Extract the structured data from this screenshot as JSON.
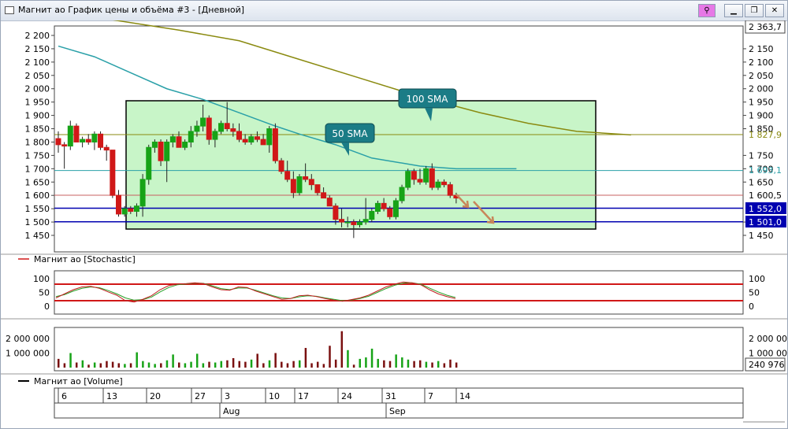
{
  "window": {
    "title": "Магнит ао График цены и объёма #3 - [Дневной]",
    "buttons": [
      "link-icon",
      "minimize-icon",
      "restore-icon",
      "close-icon"
    ]
  },
  "main_pane": {
    "y_ticks": [
      "2 200",
      "2 150",
      "2 100",
      "2 050",
      "2 000",
      "1 950",
      "1 900",
      "1 850",
      "1 800",
      "1 750",
      "1 700",
      "1 650",
      "1 600",
      "1 550",
      "1 500",
      "1 450"
    ],
    "right_ticks": [
      "2 150",
      "2 100",
      "2 050",
      "2 000",
      "1 950",
      "1 900",
      "1 850",
      "1 750",
      "1 700",
      "1 650",
      "1 500",
      "1 450"
    ],
    "top_price": "2 363,7",
    "labels": {
      "sma100": "1 827,9",
      "sma50": "1 693,1",
      "close": "1 600,5",
      "support1": "1 552,0",
      "support2": "1 501,0"
    },
    "callouts": {
      "sma100": "100 SMA",
      "sma50": "50 SMA"
    },
    "colors": {
      "up": "#17a317",
      "down": "#d01818",
      "sma50": "#2aa0a8",
      "sma100": "#8a8a10",
      "support": "#0000b0",
      "zone": "#c8f5c8",
      "arrow": "#c8865a"
    }
  },
  "stoch_pane": {
    "caption": "Магнит ао [Stochastic]",
    "ticks": [
      "100",
      "50",
      "0"
    ],
    "levels": [
      80,
      20
    ]
  },
  "vol_pane": {
    "caption": "Магнит ао [Volume]",
    "ticks": [
      "2 000 000",
      "1 000 000"
    ],
    "right_ticks": [
      "2 000 000",
      "1 000 000"
    ],
    "last": "240 976"
  },
  "date_axis": {
    "days": [
      "6",
      "13",
      "20",
      "27",
      "3",
      "10",
      "17",
      "24",
      "31",
      "7",
      "14"
    ],
    "months": [
      "Aug",
      "Sep"
    ]
  },
  "chart_data": {
    "type": "candlestick",
    "candles": [
      [
        1813,
        1840,
        1760,
        1790
      ],
      [
        1790,
        1800,
        1700,
        1785
      ],
      [
        1785,
        1880,
        1770,
        1860
      ],
      [
        1860,
        1870,
        1800,
        1800
      ],
      [
        1800,
        1820,
        1780,
        1810
      ],
      [
        1810,
        1830,
        1790,
        1800
      ],
      [
        1800,
        1840,
        1770,
        1830
      ],
      [
        1830,
        1840,
        1770,
        1780
      ],
      [
        1780,
        1790,
        1730,
        1770
      ],
      [
        1770,
        1770,
        1590,
        1600
      ],
      [
        1600,
        1620,
        1520,
        1530
      ],
      [
        1530,
        1560,
        1520,
        1550
      ],
      [
        1550,
        1560,
        1530,
        1540
      ],
      [
        1540,
        1570,
        1520,
        1560
      ],
      [
        1560,
        1680,
        1520,
        1660
      ],
      [
        1660,
        1790,
        1640,
        1780
      ],
      [
        1780,
        1810,
        1760,
        1800
      ],
      [
        1800,
        1810,
        1710,
        1730
      ],
      [
        1730,
        1810,
        1650,
        1800
      ],
      [
        1800,
        1830,
        1780,
        1820
      ],
      [
        1820,
        1840,
        1780,
        1780
      ],
      [
        1780,
        1810,
        1770,
        1800
      ],
      [
        1800,
        1860,
        1780,
        1840
      ],
      [
        1840,
        1880,
        1820,
        1860
      ],
      [
        1860,
        1940,
        1840,
        1890
      ],
      [
        1890,
        1900,
        1790,
        1810
      ],
      [
        1810,
        1850,
        1780,
        1840
      ],
      [
        1840,
        1880,
        1830,
        1870
      ],
      [
        1870,
        1950,
        1840,
        1850
      ],
      [
        1850,
        1870,
        1820,
        1840
      ],
      [
        1840,
        1870,
        1800,
        1810
      ],
      [
        1810,
        1830,
        1790,
        1800
      ],
      [
        1800,
        1830,
        1790,
        1820
      ],
      [
        1820,
        1840,
        1800,
        1810
      ],
      [
        1810,
        1830,
        1790,
        1790
      ],
      [
        1790,
        1860,
        1760,
        1850
      ],
      [
        1850,
        1870,
        1720,
        1730
      ],
      [
        1730,
        1740,
        1680,
        1690
      ],
      [
        1690,
        1730,
        1650,
        1660
      ],
      [
        1660,
        1690,
        1590,
        1610
      ],
      [
        1610,
        1680,
        1600,
        1670
      ],
      [
        1670,
        1720,
        1650,
        1660
      ],
      [
        1660,
        1680,
        1620,
        1640
      ],
      [
        1640,
        1640,
        1600,
        1610
      ],
      [
        1610,
        1630,
        1590,
        1590
      ],
      [
        1590,
        1600,
        1560,
        1560
      ],
      [
        1560,
        1570,
        1490,
        1510
      ],
      [
        1510,
        1550,
        1480,
        1500
      ],
      [
        1500,
        1520,
        1480,
        1500
      ],
      [
        1500,
        1510,
        1440,
        1490
      ],
      [
        1490,
        1510,
        1480,
        1500
      ],
      [
        1500,
        1590,
        1490,
        1510
      ],
      [
        1510,
        1550,
        1500,
        1540
      ],
      [
        1540,
        1580,
        1530,
        1570
      ],
      [
        1570,
        1590,
        1540,
        1550
      ],
      [
        1550,
        1560,
        1510,
        1520
      ],
      [
        1520,
        1590,
        1510,
        1580
      ],
      [
        1580,
        1640,
        1570,
        1630
      ],
      [
        1630,
        1700,
        1620,
        1690
      ],
      [
        1690,
        1700,
        1640,
        1660
      ],
      [
        1660,
        1700,
        1640,
        1650
      ],
      [
        1650,
        1710,
        1640,
        1700
      ],
      [
        1700,
        1720,
        1620,
        1630
      ],
      [
        1630,
        1660,
        1620,
        1650
      ],
      [
        1650,
        1660,
        1630,
        1640
      ],
      [
        1640,
        1650,
        1590,
        1600
      ],
      [
        1600,
        1610,
        1570,
        1590
      ]
    ],
    "sma50": [
      [
        0,
        2160
      ],
      [
        6,
        2120
      ],
      [
        12,
        2060
      ],
      [
        18,
        2000
      ],
      [
        24,
        1960
      ],
      [
        30,
        1910
      ],
      [
        36,
        1860
      ],
      [
        40,
        1830
      ],
      [
        46,
        1790
      ],
      [
        52,
        1740
      ],
      [
        60,
        1710
      ],
      [
        66,
        1700
      ],
      [
        76,
        1700
      ]
    ],
    "sma100": [
      [
        0,
        2290
      ],
      [
        20,
        2220
      ],
      [
        30,
        2180
      ],
      [
        40,
        2110
      ],
      [
        50,
        2040
      ],
      [
        60,
        1970
      ],
      [
        70,
        1910
      ],
      [
        78,
        1870
      ],
      [
        86,
        1840
      ],
      [
        95,
        1827
      ]
    ],
    "stochastic": {
      "k": [
        30,
        45,
        60,
        70,
        72,
        65,
        52,
        40,
        20,
        15,
        25,
        38,
        60,
        75,
        80,
        82,
        85,
        82,
        70,
        60,
        58,
        70,
        68,
        55,
        45,
        35,
        25,
        28,
        38,
        40,
        35,
        28,
        22,
        18,
        24,
        30,
        40,
        55,
        70,
        80,
        88,
        85,
        78,
        60,
        45,
        35,
        28
      ],
      "d": [
        35,
        42,
        55,
        65,
        70,
        67,
        57,
        45,
        30,
        22,
        24,
        33,
        52,
        68,
        78,
        81,
        84,
        83,
        74,
        64,
        60,
        66,
        66,
        58,
        48,
        38,
        30,
        28,
        34,
        38,
        36,
        30,
        25,
        20,
        22,
        28,
        36,
        50,
        64,
        76,
        84,
        85,
        80,
        66,
        52,
        40,
        32
      ]
    },
    "volume": [
      0.6,
      0.3,
      1.0,
      0.35,
      0.5,
      0.2,
      0.35,
      0.3,
      0.45,
      0.4,
      0.3,
      0.25,
      0.3,
      1.05,
      0.45,
      0.35,
      0.25,
      0.3,
      0.5,
      0.9,
      0.35,
      0.3,
      0.4,
      0.95,
      0.3,
      0.4,
      0.35,
      0.45,
      0.5,
      0.65,
      0.45,
      0.4,
      0.55,
      0.95,
      0.3,
      0.5,
      1.0,
      0.4,
      0.3,
      0.45,
      0.5,
      1.35,
      0.3,
      0.4,
      0.25,
      1.5,
      0.55,
      2.5,
      1.2,
      0.2,
      0.6,
      0.7,
      1.3,
      0.6,
      0.5,
      0.45,
      0.9,
      0.7,
      0.55,
      0.45,
      0.5,
      0.4,
      0.35,
      0.45,
      0.3,
      0.55,
      0.35
    ],
    "y_range": [
      1440,
      2200
    ]
  }
}
